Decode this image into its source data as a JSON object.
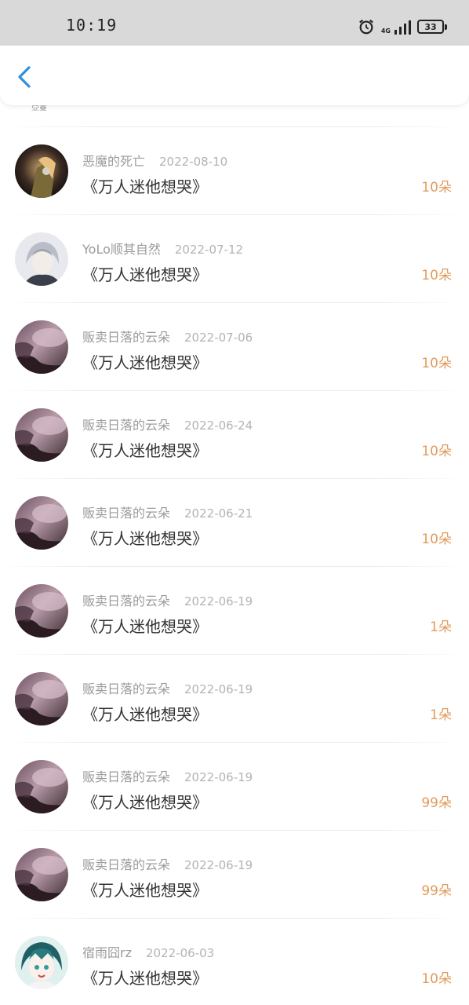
{
  "status_bar": {
    "time": "10:19",
    "network": "4G",
    "battery": "33"
  },
  "partial_top_text": "亞蔓",
  "items": [
    {
      "user": "恶魔的死亡",
      "date": "2022-08-10",
      "title": "《万人迷他想哭》",
      "count": "10朵",
      "avatar": "dark-art"
    },
    {
      "user": "YoLo顺其自然",
      "date": "2022-07-12",
      "title": "《万人迷他想哭》",
      "count": "10朵",
      "avatar": "silver-hair"
    },
    {
      "user": "贩卖日落的云朵",
      "date": "2022-07-06",
      "title": "《万人迷他想哭》",
      "count": "10朵",
      "avatar": "sunset-cloud"
    },
    {
      "user": "贩卖日落的云朵",
      "date": "2022-06-24",
      "title": "《万人迷他想哭》",
      "count": "10朵",
      "avatar": "sunset-cloud"
    },
    {
      "user": "贩卖日落的云朵",
      "date": "2022-06-21",
      "title": "《万人迷他想哭》",
      "count": "10朵",
      "avatar": "sunset-cloud"
    },
    {
      "user": "贩卖日落的云朵",
      "date": "2022-06-19",
      "title": "《万人迷他想哭》",
      "count": "1朵",
      "avatar": "sunset-cloud"
    },
    {
      "user": "贩卖日落的云朵",
      "date": "2022-06-19",
      "title": "《万人迷他想哭》",
      "count": "1朵",
      "avatar": "sunset-cloud"
    },
    {
      "user": "贩卖日落的云朵",
      "date": "2022-06-19",
      "title": "《万人迷他想哭》",
      "count": "99朵",
      "avatar": "sunset-cloud"
    },
    {
      "user": "贩卖日落的云朵",
      "date": "2022-06-19",
      "title": "《万人迷他想哭》",
      "count": "99朵",
      "avatar": "sunset-cloud"
    },
    {
      "user": "宿雨囧rz",
      "date": "2022-06-03",
      "title": "《万人迷他想哭》",
      "count": "10朵",
      "avatar": "teal-anime"
    }
  ],
  "colors": {
    "accent_blue": "#2f8fe0",
    "count_orange": "#e39a5a",
    "status_bar_bg": "#d9d9d9"
  }
}
